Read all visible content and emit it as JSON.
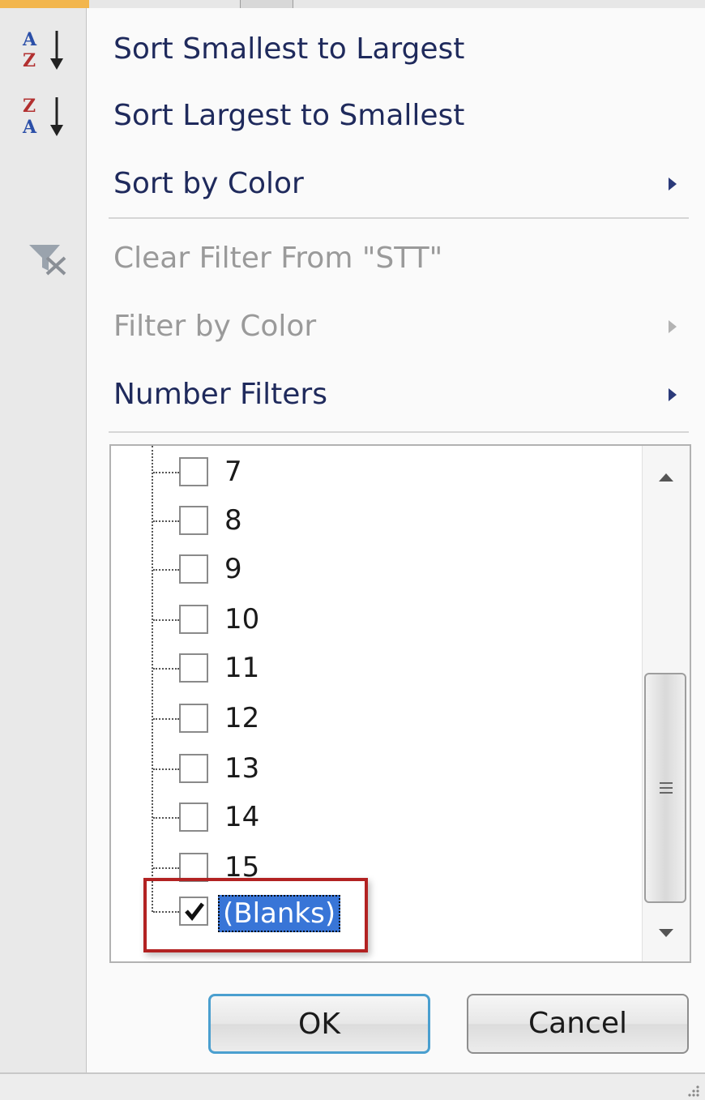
{
  "menu": {
    "items": [
      {
        "label": "Sort Smallest to Largest",
        "icon": "sort-ascending-icon",
        "enabled": true,
        "submenu": false
      },
      {
        "label": "Sort Largest to Smallest",
        "icon": "sort-descending-icon",
        "enabled": true,
        "submenu": false
      },
      {
        "label": "Sort by Color",
        "enabled": true,
        "submenu": true
      },
      {
        "label": "Clear Filter From \"STT\"",
        "icon": "clear-filter-icon",
        "enabled": false,
        "submenu": false
      },
      {
        "label": "Filter by Color",
        "enabled": false,
        "submenu": true
      },
      {
        "label": "Number Filters",
        "enabled": true,
        "submenu": true
      }
    ]
  },
  "filter_list": {
    "items": [
      {
        "label": "7",
        "checked": false
      },
      {
        "label": "8",
        "checked": false
      },
      {
        "label": "9",
        "checked": false
      },
      {
        "label": "10",
        "checked": false
      },
      {
        "label": "11",
        "checked": false
      },
      {
        "label": "12",
        "checked": false
      },
      {
        "label": "13",
        "checked": false
      },
      {
        "label": "14",
        "checked": false
      },
      {
        "label": "15",
        "checked": false
      },
      {
        "label": "(Blanks)",
        "checked": true,
        "selected": true
      }
    ]
  },
  "buttons": {
    "ok": "OK",
    "cancel": "Cancel"
  },
  "colors": {
    "accent_highlight": "#b22222",
    "selection": "#3875d7",
    "menu_text": "#1f2a5c",
    "disabled_text": "#9a9a9a"
  }
}
